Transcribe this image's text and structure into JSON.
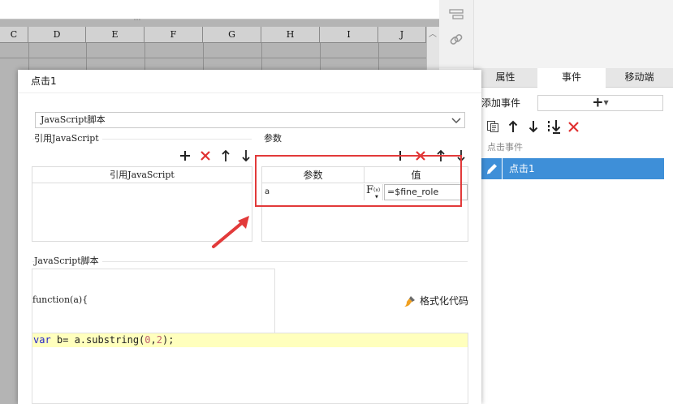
{
  "sheet": {
    "columns": [
      "C",
      "D",
      "E",
      "F",
      "G",
      "H",
      "I",
      "J"
    ],
    "more_dots": "⋯"
  },
  "property_panel": {
    "tabs": [
      {
        "label": "属性",
        "active": false
      },
      {
        "label": "事件",
        "active": true
      },
      {
        "label": "移动端",
        "active": false
      }
    ],
    "add_event_label": "添加事件",
    "add_event_button": "+",
    "event_group": "点击事件",
    "event_item": "点击1",
    "accent": "#3e8fd8"
  },
  "dialog": {
    "title": "点击1",
    "script_type": "JavaScript脚本",
    "ref_section_label": "引用JavaScript",
    "ref_column_header": "引用JavaScript",
    "param_section_label": "参数",
    "param_headers": [
      "参数",
      "值"
    ],
    "param_rows": [
      {
        "name": "a",
        "value": "=$fine_role"
      }
    ],
    "fx_label": "F",
    "fx_sub": "(x)",
    "js_section_label": "JavaScript脚本",
    "function_signature": "function(a){",
    "format_button": "格式化代码",
    "code": {
      "keyword": "var",
      "before_args": " b= a.substring(",
      "arg1": "0",
      "comma": ",",
      "arg2": "2",
      "after_args": ");"
    },
    "highlight_color": "#e23a3a"
  }
}
